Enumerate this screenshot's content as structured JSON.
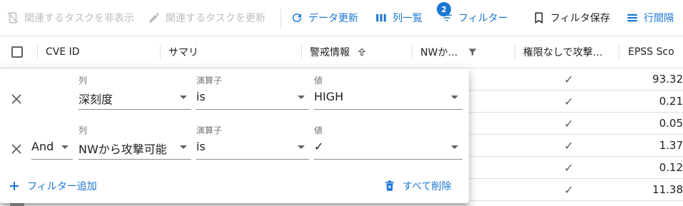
{
  "toolbar": {
    "hide_related": "関連するタスクを非表示",
    "update_related": "関連するタスクを更新",
    "refresh": "データ更新",
    "columns": "列一覧",
    "filter": "フィルター",
    "filter_badge": "2",
    "save_filter": "フィルタ保存",
    "row_spacing": "行間隔"
  },
  "grid": {
    "headers": {
      "cve_id": "CVE ID",
      "summary": "サマリ",
      "alert": "警戒情報",
      "nw": "NWか…",
      "no_priv": "権限なしで攻撃…",
      "epss": "EPSS Sco"
    },
    "rows": [
      {
        "check": "✓",
        "epss": "93.32"
      },
      {
        "check": "✓",
        "epss": "0.21"
      },
      {
        "check": "✓",
        "epss": "0.05"
      },
      {
        "check": "✓",
        "epss": "1.37"
      },
      {
        "check": "✓",
        "epss": "0.12"
      },
      {
        "check": "✓",
        "epss": "11.38"
      }
    ]
  },
  "filter_panel": {
    "rows": [
      {
        "logic": "",
        "column_label": "列",
        "column_value": "深刻度",
        "operator_label": "演算子",
        "operator_value": "is",
        "value_label": "値",
        "value_value": "HIGH"
      },
      {
        "logic": "And",
        "column_label": "列",
        "column_value": "NWから攻撃可能",
        "operator_label": "演算子",
        "operator_value": "is",
        "value_label": "値",
        "value_value": "✓"
      }
    ],
    "add_filter": "フィルター追加",
    "delete_all": "すべて削除"
  },
  "colors": {
    "primary": "#1976d2",
    "disabled": "#bdbdbd",
    "text": "#212121"
  }
}
